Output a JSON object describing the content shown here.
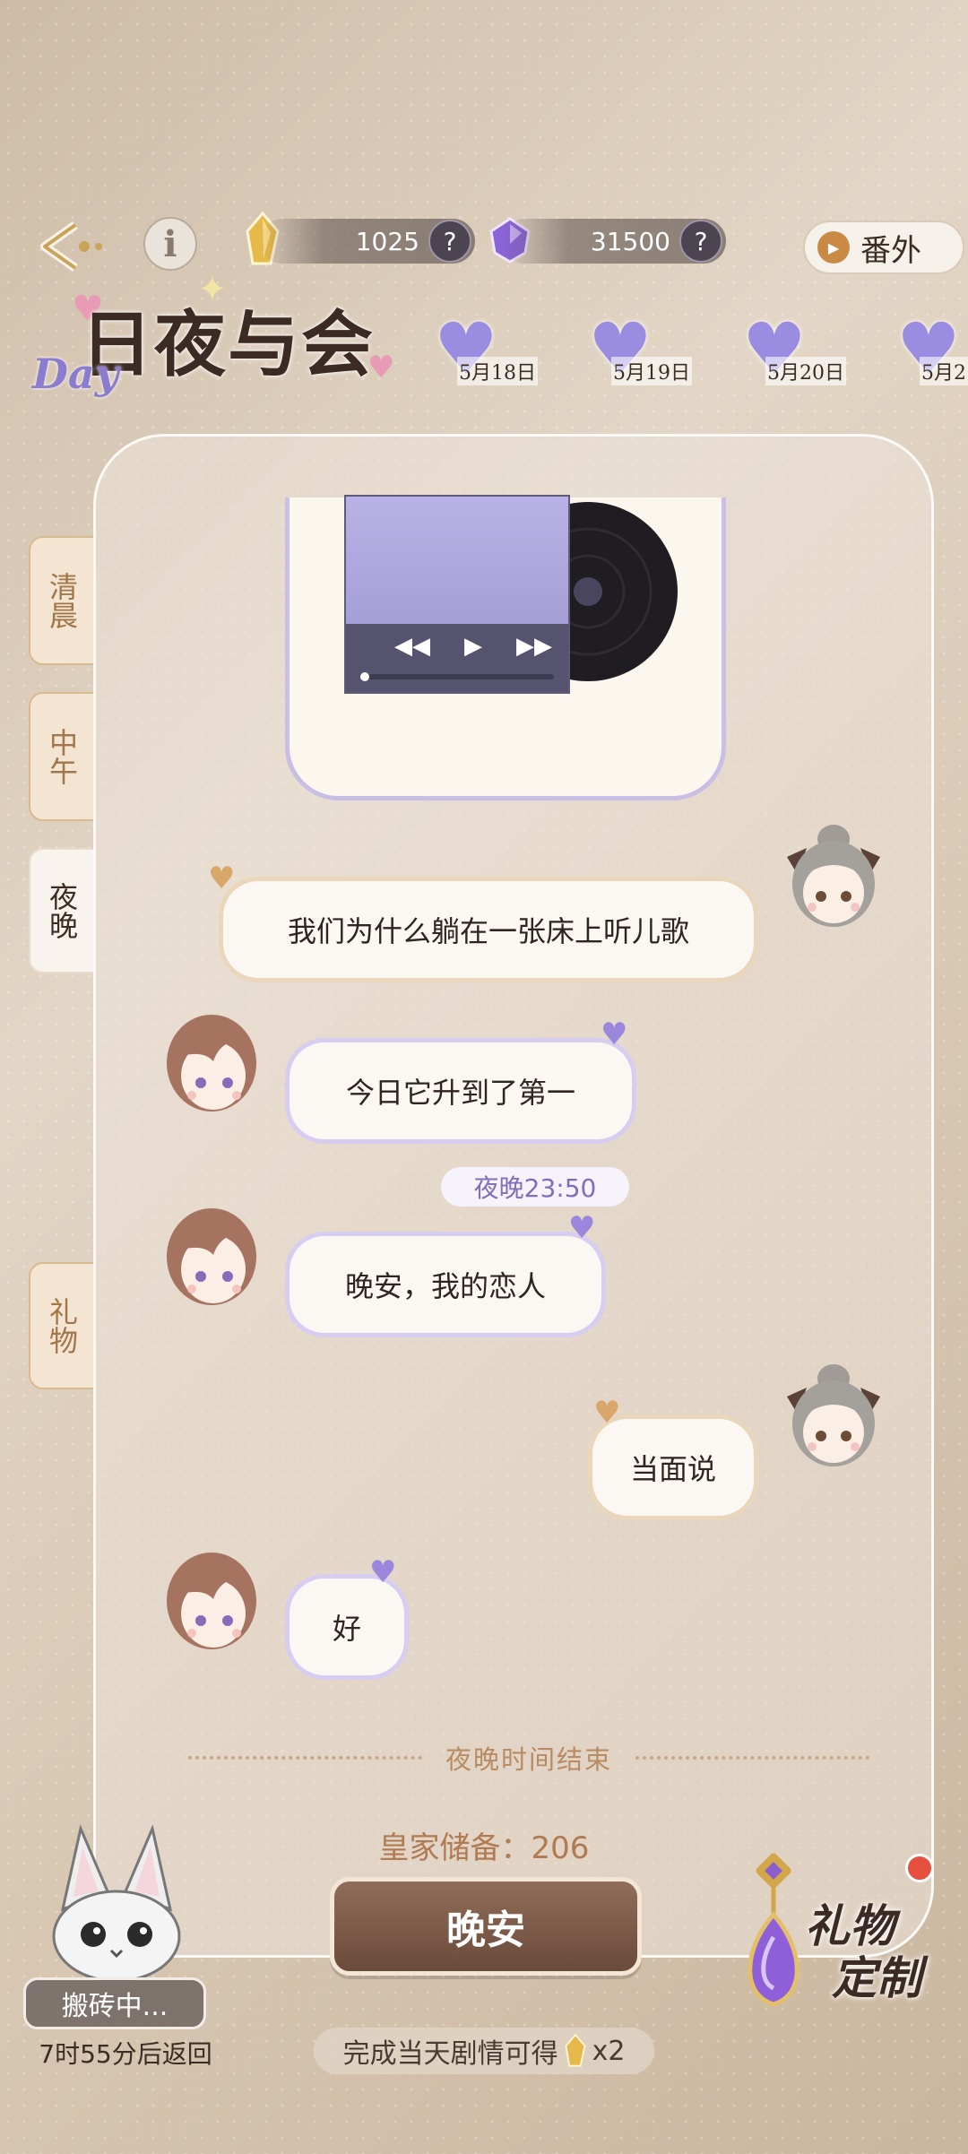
{
  "header": {
    "currency_gold": "1025",
    "currency_purple": "31500",
    "help_mark": "?",
    "extra_button": "番外"
  },
  "title": {
    "main": "日夜与会",
    "day": "Day"
  },
  "date_tabs": [
    "5月18日",
    "5月19日",
    "5月20日",
    "5月2"
  ],
  "side_tabs": {
    "morning": "清晨",
    "noon": "中午",
    "night": "夜晚",
    "gift": "礼物"
  },
  "messages": [
    {
      "from": "me",
      "text": "我们为什么躺在一张床上听儿歌"
    },
    {
      "from": "him",
      "text": "今日它升到了第一"
    },
    {
      "from": "him",
      "text": "晚安，我的恋人"
    },
    {
      "from": "me",
      "text": "当面说"
    },
    {
      "from": "him",
      "text": "好"
    }
  ],
  "time_stamp": "夜晚23:50",
  "end_text": "夜晚时间结束",
  "reserve": "皇家储备：206",
  "night_button": "晚安",
  "hint": {
    "text": "完成当天剧情可得",
    "multiplier": "x2"
  },
  "status": {
    "working": "搬砖中...",
    "return": "7时55分后返回"
  },
  "gift_custom": {
    "line1": "礼物",
    "line2": "定制"
  },
  "colors": {
    "accent_purple": "#9a8ce0",
    "button_brown": "#6a4a3a",
    "gold": "#d9a93c"
  }
}
